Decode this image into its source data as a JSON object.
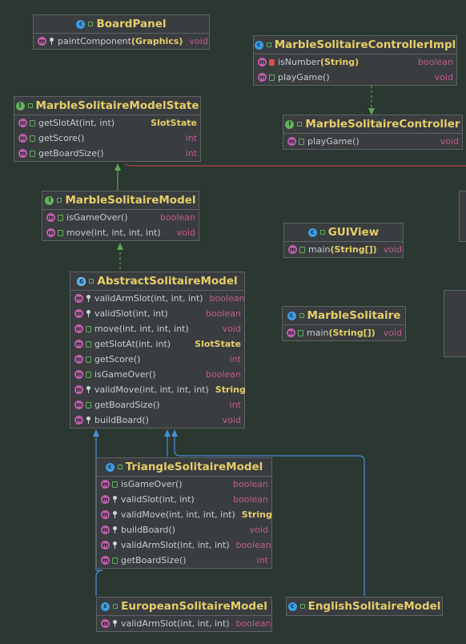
{
  "classes": {
    "board_panel": {
      "name": "BoardPanel",
      "members": [
        {
          "name": "paintComponent",
          "params": "(Graphics)",
          "ret": "void"
        }
      ]
    },
    "controller_impl": {
      "name": "MarbleSolitaireControllerImpl",
      "members": [
        {
          "name": "isNumber",
          "params": "(String)",
          "ret": "boolean"
        },
        {
          "name": "playGame",
          "params": "()",
          "ret": "void"
        }
      ]
    },
    "model_state": {
      "name": "MarbleSolitaireModelState",
      "members": [
        {
          "name": "getSlotAt",
          "params": "(int, int)",
          "ret": "SlotState"
        },
        {
          "name": "getScore",
          "params": "()",
          "ret": "int"
        },
        {
          "name": "getBoardSize",
          "params": "()",
          "ret": "int"
        }
      ]
    },
    "controller": {
      "name": "MarbleSolitaireController",
      "members": [
        {
          "name": "playGame",
          "params": "()",
          "ret": "void"
        }
      ]
    },
    "model": {
      "name": "MarbleSolitaireModel",
      "members": [
        {
          "name": "isGameOver",
          "params": "()",
          "ret": "boolean"
        },
        {
          "name": "move",
          "params": "(int, int, int, int)",
          "ret": "void"
        }
      ]
    },
    "gui_view": {
      "name": "GUIView",
      "members": [
        {
          "name": "main",
          "params": "(String[])",
          "ret": "void"
        }
      ]
    },
    "abstract_model": {
      "name": "AbstractSolitaireModel",
      "members": [
        {
          "name": "validArmSlot",
          "params": "(int, int, int)",
          "ret": "boolean"
        },
        {
          "name": "validSlot",
          "params": "(int, int)",
          "ret": "boolean"
        },
        {
          "name": "move",
          "params": "(int, int, int, int)",
          "ret": "void"
        },
        {
          "name": "getSlotAt",
          "params": "(int, int)",
          "ret": "SlotState"
        },
        {
          "name": "getScore",
          "params": "()",
          "ret": "int"
        },
        {
          "name": "isGameOver",
          "params": "()",
          "ret": "boolean"
        },
        {
          "name": "validMove",
          "params": "(int, int, int, int)",
          "ret": "String"
        },
        {
          "name": "getBoardSize",
          "params": "()",
          "ret": "int"
        },
        {
          "name": "buildBoard",
          "params": "()",
          "ret": "void"
        }
      ]
    },
    "marble_solitaire": {
      "name": "MarbleSolitaire",
      "members": [
        {
          "name": "main",
          "params": "(String[])",
          "ret": "void"
        }
      ]
    },
    "triangle_model": {
      "name": "TriangleSolitaireModel",
      "members": [
        {
          "name": "isGameOver",
          "params": "()",
          "ret": "boolean"
        },
        {
          "name": "validSlot",
          "params": "(int, int)",
          "ret": "boolean"
        },
        {
          "name": "validMove",
          "params": "(int, int, int, int)",
          "ret": "String"
        },
        {
          "name": "buildBoard",
          "params": "()",
          "ret": "void"
        },
        {
          "name": "validArmSlot",
          "params": "(int, int, int)",
          "ret": "boolean"
        },
        {
          "name": "getBoardSize",
          "params": "()",
          "ret": "int"
        }
      ]
    },
    "european_model": {
      "name": "EuropeanSolitaireModel",
      "members": [
        {
          "name": "validArmSlot",
          "params": "(int, int, int)",
          "ret": "boolean"
        }
      ]
    },
    "english_model": {
      "name": "EnglishSolitaireModel",
      "members": []
    }
  },
  "colors": {
    "background": "#2b3731",
    "box": "#393d3f",
    "class_name": "#e6ce6a",
    "return_type": "#c45b8e",
    "implements_arrow": "#5fa84f",
    "extends_arrow": "#4a90d9",
    "association": "#d04848"
  }
}
